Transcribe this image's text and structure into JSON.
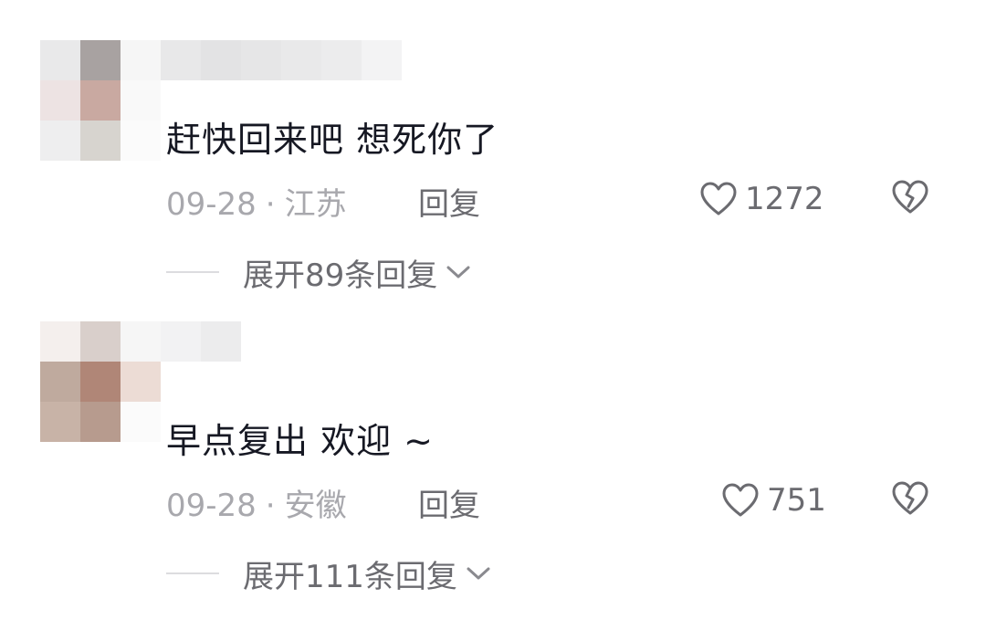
{
  "comments": [
    {
      "text": "赶快回来吧 想死你了",
      "date": "09-28",
      "separator": "·",
      "location": "江苏",
      "reply_label": "回复",
      "like_count": "1272",
      "expand_label": "展开89条回复",
      "avatar_colors": [
        "#e9e9ea",
        "#a8a2a1",
        "#f6f6f6",
        "#ede3e3",
        "#c9a9a1",
        "#f9f9f9",
        "#eeeeef",
        "#d7d4cf",
        "#fbfbfb"
      ],
      "username_colors": [
        "#e8e8e9",
        "#e3e3e4",
        "#e6e6e7",
        "#e9e9ea",
        "#ececed",
        "#f3f3f4"
      ]
    },
    {
      "text": "早点复出 欢迎 ~",
      "date": "09-28",
      "separator": "·",
      "location": "安徽",
      "reply_label": "回复",
      "like_count": "751",
      "expand_label": "展开111条回复",
      "avatar_colors": [
        "#f4efed",
        "#d9cfcb",
        "#f6f6f6",
        "#bfaa9e",
        "#b08677",
        "#ecdcd5",
        "#c8b3a7",
        "#b79b8e",
        "#fbfbfb"
      ],
      "username_colors": [
        "#f2f2f3",
        "#ececed"
      ]
    }
  ],
  "colors": {
    "text": "#161823",
    "meta": "#a8a8ad",
    "action": "#6b6b70"
  },
  "icons": {
    "like": "heart-outline-icon",
    "dislike": "broken-heart-icon",
    "expand": "chevron-down-icon"
  }
}
